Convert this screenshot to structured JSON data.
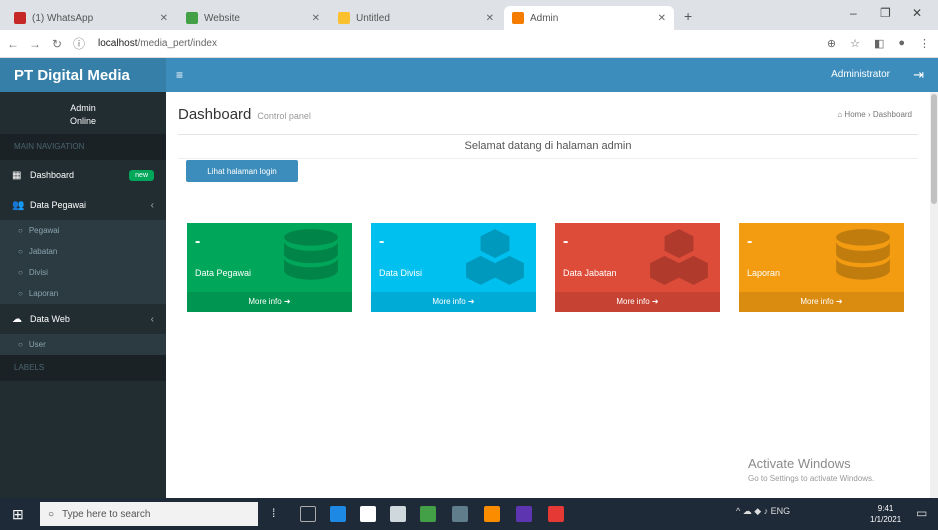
{
  "browser": {
    "tabs": [
      {
        "title": "(1) WhatsApp",
        "favicon_color": "#c62828"
      },
      {
        "title": "Website",
        "favicon_color": "#43a047"
      },
      {
        "title": "Untitled",
        "favicon_color": "#fbc02d"
      },
      {
        "title": "Admin",
        "favicon_color": "#f57c00"
      }
    ],
    "new_tab": "+",
    "window_controls": [
      "–",
      "❐",
      "✕"
    ],
    "url_host": "localhost",
    "url_path": "/media_pert/index"
  },
  "app": {
    "logo": "PT Digital Media",
    "toggle": "≡",
    "user": "Administrator",
    "logout": "⇥"
  },
  "sidebar": {
    "user_name": "Admin",
    "user_status": "Online",
    "header_main": "MAIN NAVIGATION",
    "dashboard": {
      "label": "Dashboard",
      "badge": "new"
    },
    "data_pegawai": {
      "label": "Data Pegawai",
      "arrow": "‹"
    },
    "submenu_pegawai": [
      "Pegawai",
      "Jabatan",
      "Divisi",
      "Laporan"
    ],
    "data_web": {
      "label": "Data Web",
      "arrow": "‹"
    },
    "submenu_web": [
      "User"
    ],
    "header_second": "LABELS"
  },
  "page": {
    "title": "Dashboard",
    "subtitle": "Control panel",
    "breadcrumb": "⌂ Home › Dashboard",
    "welcome": "Selamat datang di halaman admin",
    "login_button": "Lihat halaman login"
  },
  "boxes": [
    {
      "value": "-",
      "label": "Data Pegawai",
      "footer": "More info ➜",
      "color": "#00a65a",
      "icon": "database-icon"
    },
    {
      "value": "-",
      "label": "Data Divisi",
      "footer": "More info ➜",
      "color": "#00c0ef",
      "icon": "cubes-icon"
    },
    {
      "value": "-",
      "label": "Data Jabatan",
      "footer": "More info ➜",
      "color": "#dd4b39",
      "icon": "cubes-icon"
    },
    {
      "value": "-",
      "label": "Laporan",
      "footer": "More info ➜",
      "color": "#f39c12",
      "icon": "database-icon"
    }
  ],
  "watermark": {
    "line1": "Activate Windows",
    "line2": "Go to Settings to activate Windows."
  },
  "taskbar": {
    "search_placeholder": "Type here to search",
    "tray": "^ ☁ ◆ ♪ ENG",
    "time": "9:41",
    "date": "1/1/2021"
  }
}
